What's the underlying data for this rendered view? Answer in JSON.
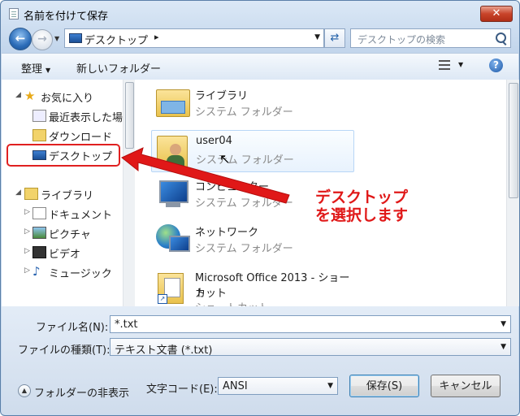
{
  "window": {
    "title": "名前を付けて保存",
    "close_label": "✕"
  },
  "nav": {
    "address": "デスクトップ",
    "address_sep": "▸",
    "search_placeholder": "デスクトップの検索"
  },
  "toolbar": {
    "organize": "整理",
    "new_folder": "新しいフォルダー"
  },
  "sidebar": {
    "favorites": "お気に入り",
    "recent": "最近表示した場所",
    "downloads": "ダウンロード",
    "desktop": "デスクトップ",
    "libraries": "ライブラリ",
    "documents": "ドキュメント",
    "pictures": "ピクチャ",
    "videos": "ビデオ",
    "music": "ミュージック"
  },
  "files": [
    {
      "name": "ライブラリ",
      "type": "システム フォルダー"
    },
    {
      "name": "user04",
      "type": "システム フォルダー"
    },
    {
      "name": "コンピューター",
      "type": "システム フォルダー"
    },
    {
      "name": "ネットワーク",
      "type": "システム フォルダー"
    },
    {
      "name": "Microsoft Office 2013 - ショート",
      "name2": "カット",
      "type": "ショートカット"
    }
  ],
  "form": {
    "filename_label": "ファイル名(N):",
    "filename_value": "*.txt",
    "filetype_label": "ファイルの種類(T):",
    "filetype_value": "テキスト文書 (*.txt)",
    "hide_folders": "フォルダーの非表示",
    "encoding_label": "文字コード(E):",
    "encoding_value": "ANSI",
    "save_button": "保存(S)",
    "cancel_button": "キャンセル"
  },
  "annotation": {
    "line1": "デスクトップ",
    "line2": "を選択します"
  },
  "colors": {
    "annotation_red": "#e01818",
    "selection_blue": "#b8d6f6"
  }
}
